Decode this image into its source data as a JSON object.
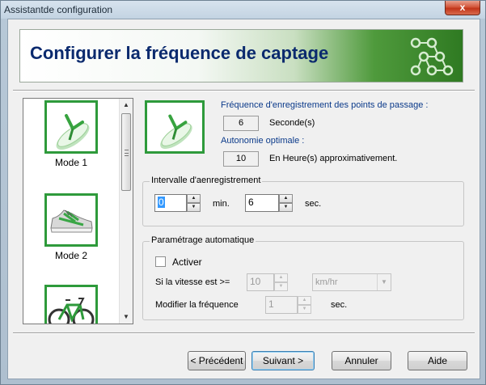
{
  "window": {
    "title": "Assistantde configuration",
    "close_glyph": "x"
  },
  "banner": {
    "title": "Configurer la fréquence de captage",
    "logo_icon": "dots-network-icon"
  },
  "modes": [
    {
      "label": "Mode 1",
      "icon": "sandal-icon"
    },
    {
      "label": "Mode 2",
      "icon": "sneaker-icon"
    },
    {
      "label": "",
      "icon": "bicycle-icon"
    }
  ],
  "info": {
    "freq_label": "Fréquence d'enregistrement des points de passage :",
    "freq_value": "6",
    "freq_unit": "Seconde(s)",
    "autonomy_label": "Autonomie optimale :",
    "autonomy_value": "10",
    "autonomy_unit": "En Heure(s) approximativement."
  },
  "interval": {
    "title": "Intervalle d'aenregistrement",
    "min_value": "0",
    "min_label": "min.",
    "sec_value": "6",
    "sec_label": "sec."
  },
  "auto": {
    "title": "Paramétrage automatique",
    "activate_label": "Activer",
    "activate_checked": false,
    "speed_label": "Si la vitesse est  >=",
    "speed_value": "10",
    "speed_unit": "km/hr",
    "modify_label": "Modifier la fréquence",
    "modify_value": "1",
    "modify_unit": "sec."
  },
  "buttons": {
    "previous": "< Précédent",
    "next": "Suivant >",
    "cancel": "Annuler",
    "help": "Aide"
  },
  "colors": {
    "accent_green": "#2e9a3b",
    "title_blue": "#0b2a6e",
    "label_blue": "#0b3a8a"
  }
}
